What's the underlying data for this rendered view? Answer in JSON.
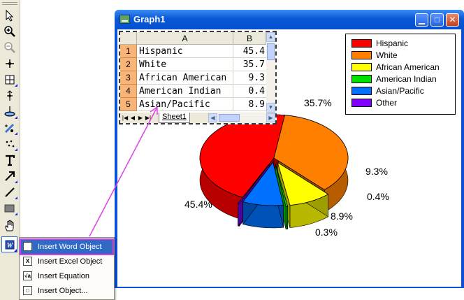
{
  "window": {
    "title": "Graph1"
  },
  "toolbar": {
    "tools": [
      {
        "name": "pointer-icon"
      },
      {
        "name": "zoom-in-icon"
      },
      {
        "name": "zoom-out-icon"
      },
      {
        "name": "screen-reader-icon"
      },
      {
        "name": "data-selector-icon"
      },
      {
        "name": "data-reader-icon"
      },
      {
        "name": "mask-tool-icon"
      },
      {
        "name": "draw-data-icon"
      },
      {
        "name": "region-select-icon"
      },
      {
        "name": "text-tool-icon"
      },
      {
        "name": "arrow-tool-icon"
      },
      {
        "name": "line-tool-icon"
      },
      {
        "name": "rectangle-tool-icon"
      },
      {
        "name": "hand-tool-icon"
      },
      {
        "name": "insert-object-icon"
      }
    ]
  },
  "worksheet": {
    "columns": [
      "A",
      "B"
    ],
    "rows": [
      {
        "num": "1",
        "a": "Hispanic",
        "b": "45.4"
      },
      {
        "num": "2",
        "a": "White",
        "b": "35.7"
      },
      {
        "num": "3",
        "a": "African American",
        "b": "9.3"
      },
      {
        "num": "4",
        "a": "American Indian",
        "b": "0.4"
      },
      {
        "num": "5",
        "a": "Asian/Pacific",
        "b": "8.9"
      }
    ],
    "tab": "Sheet1"
  },
  "legend": [
    {
      "label": "Hispanic",
      "color": "#ff0000"
    },
    {
      "label": "White",
      "color": "#ff8000"
    },
    {
      "label": "African American",
      "color": "#ffff00"
    },
    {
      "label": "American Indian",
      "color": "#00e000"
    },
    {
      "label": "Asian/Pacific",
      "color": "#0070ff"
    },
    {
      "label": "Other",
      "color": "#8000ff"
    }
  ],
  "chart_data": {
    "type": "pie",
    "categories": [
      "Hispanic",
      "White",
      "African American",
      "American Indian",
      "Asian/Pacific",
      "Other"
    ],
    "values": [
      45.4,
      35.7,
      9.3,
      0.4,
      8.9,
      0.3
    ],
    "data_labels": [
      "45.4%",
      "35.7%",
      "9.3%",
      "0.4%",
      "8.9%",
      "0.3%"
    ],
    "colors": [
      "#ff0000",
      "#ff8000",
      "#ffff00",
      "#00e000",
      "#0070ff",
      "#8000ff"
    ],
    "style": "3d-exploded",
    "legend_position": "top-right"
  },
  "context_menu": {
    "items": [
      {
        "label": "Insert Word Object",
        "icon": "word-object-icon",
        "glyph": "W"
      },
      {
        "label": "Insert Excel Object",
        "icon": "excel-object-icon",
        "glyph": "X"
      },
      {
        "label": "Insert Equation",
        "icon": "equation-icon",
        "glyph": "√a"
      },
      {
        "label": "Insert Object...",
        "icon": "object-icon",
        "glyph": "□"
      }
    ]
  }
}
